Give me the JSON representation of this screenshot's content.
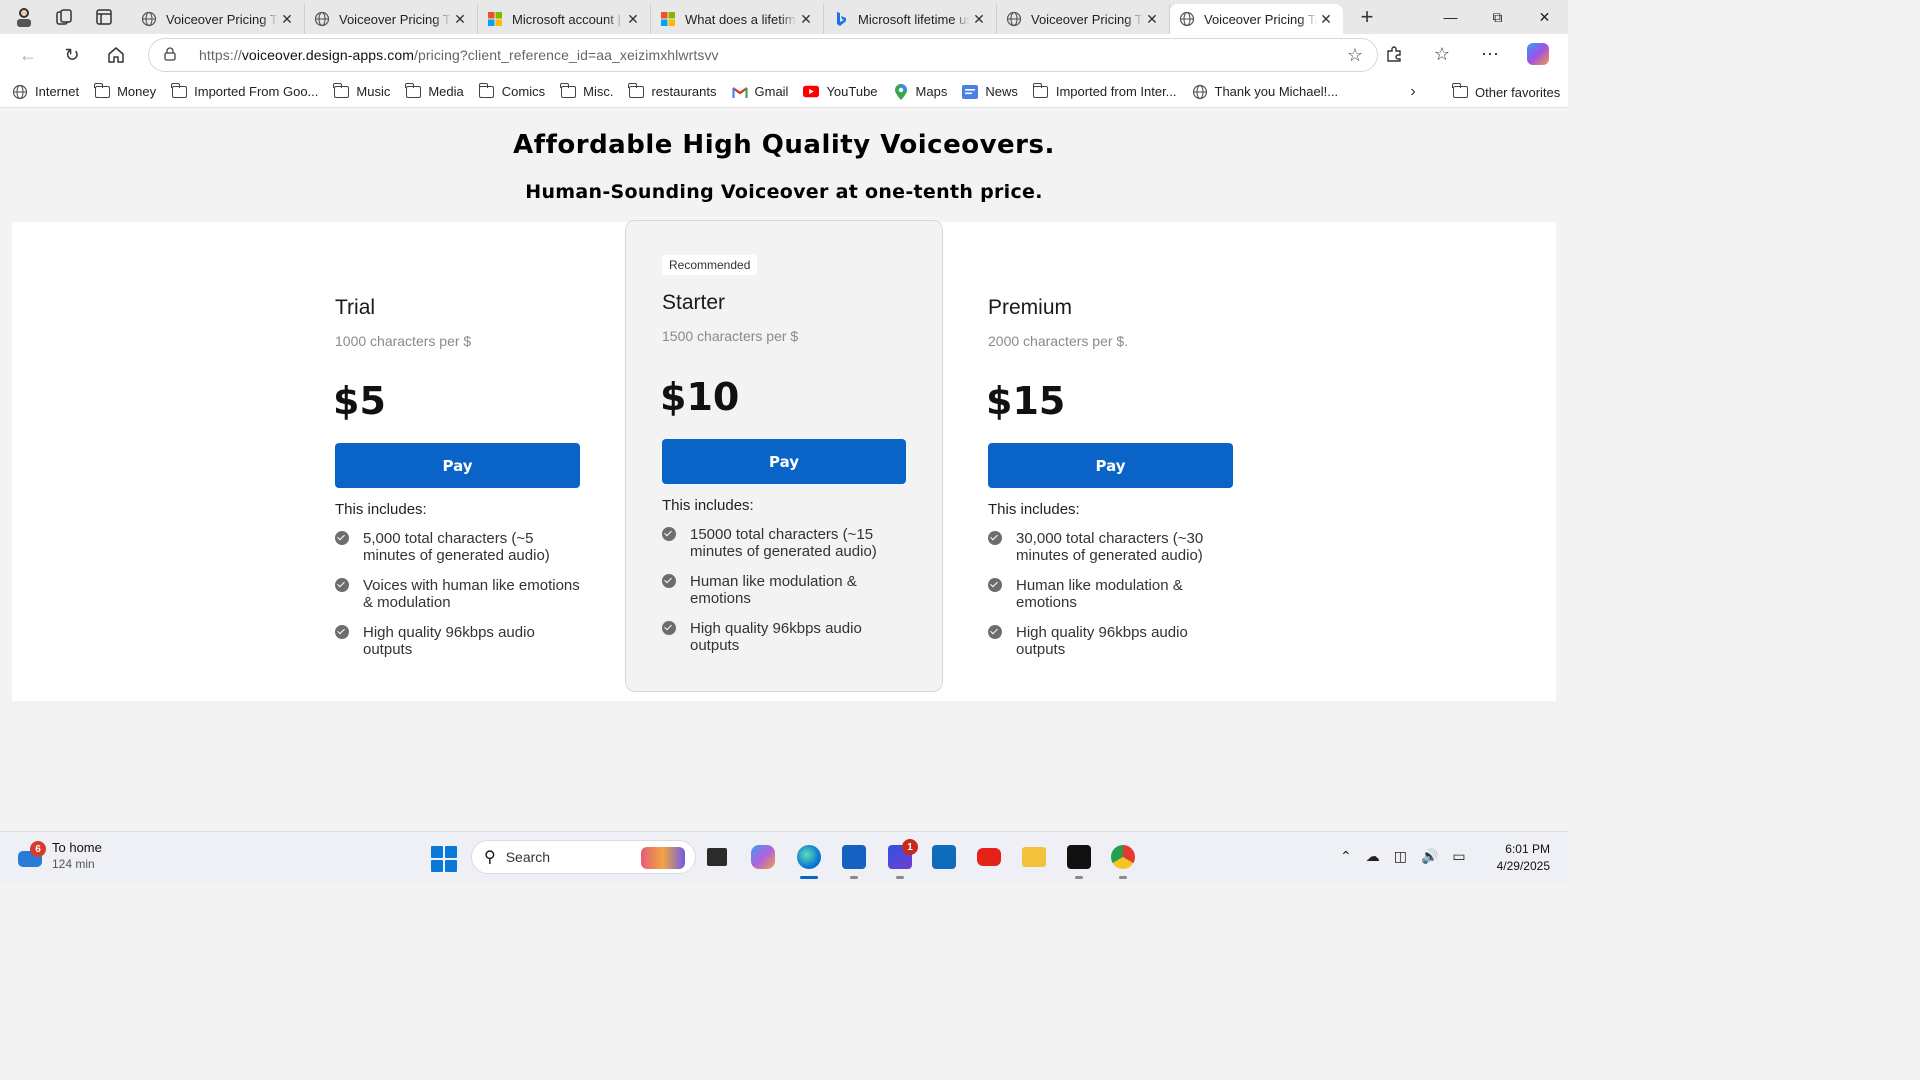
{
  "browser": {
    "tabs": [
      {
        "title": "Voiceover Pricing Ta",
        "favicon": "globe-icon",
        "active": false
      },
      {
        "title": "Voiceover Pricing Ta",
        "favicon": "globe-icon",
        "active": false
      },
      {
        "title": "Microsoft account | C",
        "favicon": "microsoft-icon",
        "active": false
      },
      {
        "title": "What does a lifetime",
        "favicon": "microsoft-icon",
        "active": false
      },
      {
        "title": "Microsoft lifetime us",
        "favicon": "bing-icon",
        "active": false
      },
      {
        "title": "Voiceover Pricing Ta",
        "favicon": "globe-icon",
        "active": false
      },
      {
        "title": "Voiceover Pricing Ta",
        "favicon": "globe-icon",
        "active": true
      }
    ],
    "url_prefix": "https://",
    "url_host": "voiceover.design-apps.com",
    "url_path": "/pricing?client_reference_id=aa_xeizimxhlwrtsvv",
    "favorites": [
      {
        "label": "Internet",
        "icon": "globe-icon"
      },
      {
        "label": "Money",
        "icon": "folder-icon"
      },
      {
        "label": "Imported From Goo...",
        "icon": "folder-icon"
      },
      {
        "label": "Music",
        "icon": "folder-icon"
      },
      {
        "label": "Media",
        "icon": "folder-icon"
      },
      {
        "label": "Comics",
        "icon": "folder-icon"
      },
      {
        "label": "Misc.",
        "icon": "folder-icon"
      },
      {
        "label": "restaurants",
        "icon": "folder-icon"
      },
      {
        "label": "Gmail",
        "icon": "gmail-icon"
      },
      {
        "label": "YouTube",
        "icon": "youtube-icon"
      },
      {
        "label": "Maps",
        "icon": "maps-icon"
      },
      {
        "label": "News",
        "icon": "news-icon"
      },
      {
        "label": "Imported from Inter...",
        "icon": "folder-icon"
      },
      {
        "label": "Thank you Michael!...",
        "icon": "globe-icon"
      }
    ],
    "other_favorites": "Other favorites"
  },
  "page": {
    "title": "Affordable High Quality Voiceovers.",
    "subtitle": "Human-Sounding Voiceover at one-tenth price.",
    "includes_label": "This includes:",
    "pay_label": "Pay",
    "recommended_label": "Recommended",
    "plans": [
      {
        "name": "Trial",
        "rate": "1000 characters per $",
        "price": "$5",
        "features": [
          "5,000 total characters (~5 minutes of generated audio)",
          "Voices with human like emotions & modulation",
          "High quality 96kbps audio outputs"
        ]
      },
      {
        "name": "Starter",
        "rate": "1500 characters per $",
        "price": "$10",
        "features": [
          "15000 total characters (~15 minutes of generated audio)",
          "Human like modulation & emotions",
          "High quality 96kbps audio outputs"
        ]
      },
      {
        "name": "Premium",
        "rate": "2000 characters per $.",
        "price": "$15",
        "features": [
          "30,000 total characters (~30 minutes of generated audio)",
          "Human like modulation & emotions",
          "High quality 96kbps audio outputs"
        ]
      }
    ]
  },
  "taskbar": {
    "weather_badge": "6",
    "weather_line1": "To home",
    "weather_line2": "124 min",
    "search_label": "Search",
    "app_badge": "1",
    "time": "6:01 PM",
    "date": "4/29/2025"
  },
  "colors": {
    "pay_button": "#0a64c8",
    "recommended_card_bg": "#f3f3f3"
  }
}
